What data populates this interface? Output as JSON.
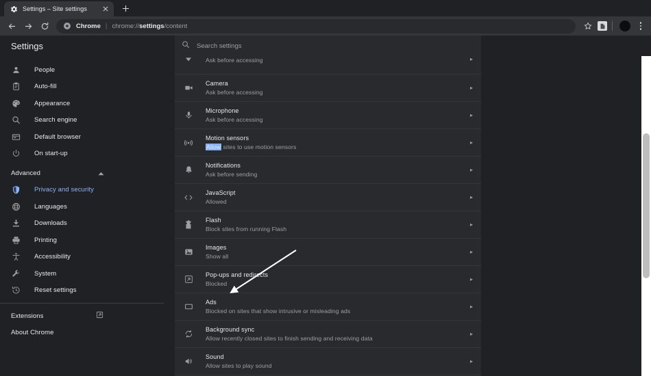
{
  "browser": {
    "tab": {
      "title": "Settings – Site settings",
      "favicon_icon": "gear-icon",
      "close_icon": "close-icon"
    },
    "newtab_label": "+",
    "toolbar": {
      "back_icon": "arrow-left-icon",
      "forward_icon": "arrow-right-icon",
      "reload_icon": "reload-icon",
      "security_icon": "chrome-globe-icon",
      "chip_label": "Chrome",
      "separator": "|",
      "url_prefix": "chrome://",
      "url_bold": "settings",
      "url_suffix": "/content",
      "bookmark_icon": "star-icon",
      "extension_icon": "extension-icon",
      "avatar_icon": "avatar",
      "menu_icon": "kebab-menu-icon"
    }
  },
  "settings": {
    "header_title": "Settings",
    "search": {
      "placeholder": "Search settings",
      "icon": "search-icon"
    }
  },
  "sidebar": {
    "items": [
      {
        "label": "People",
        "icon": "person-icon",
        "active": false
      },
      {
        "label": "Auto-fill",
        "icon": "clipboard-icon",
        "active": false
      },
      {
        "label": "Appearance",
        "icon": "palette-icon",
        "active": false
      },
      {
        "label": "Search engine",
        "icon": "search-icon",
        "active": false
      },
      {
        "label": "Default browser",
        "icon": "browser-window-icon",
        "active": false
      },
      {
        "label": "On start-up",
        "icon": "power-icon",
        "active": false
      }
    ],
    "advanced": {
      "label": "Advanced",
      "chevron_icon": "chevron-up-icon"
    },
    "advanced_items": [
      {
        "label": "Privacy and security",
        "icon": "shield-icon",
        "active": true
      },
      {
        "label": "Languages",
        "icon": "globe-icon",
        "active": false
      },
      {
        "label": "Downloads",
        "icon": "download-icon",
        "active": false
      },
      {
        "label": "Printing",
        "icon": "printer-icon",
        "active": false
      },
      {
        "label": "Accessibility",
        "icon": "accessibility-icon",
        "active": false
      },
      {
        "label": "System",
        "icon": "wrench-icon",
        "active": false
      },
      {
        "label": "Reset settings",
        "icon": "history-restore-icon",
        "active": false
      }
    ],
    "footer_items": [
      {
        "label": "Extensions",
        "external_icon": "external-link-icon"
      },
      {
        "label": "About Chrome",
        "external_icon": null
      }
    ]
  },
  "content_settings": {
    "rows": [
      {
        "title": "",
        "subtitle": "Ask before accessing",
        "icon": "location-pin-icon",
        "partial": true,
        "highlight": null
      },
      {
        "title": "Camera",
        "subtitle": "Ask before accessing",
        "icon": "camera-icon",
        "partial": false,
        "highlight": null
      },
      {
        "title": "Microphone",
        "subtitle": "Ask before accessing",
        "icon": "microphone-icon",
        "partial": false,
        "highlight": null
      },
      {
        "title": "Motion sensors",
        "subtitle": " sites to use motion sensors",
        "icon": "motion-sensor-icon",
        "partial": false,
        "highlight": "Allow"
      },
      {
        "title": "Notifications",
        "subtitle": "Ask before sending",
        "icon": "bell-icon",
        "partial": false,
        "highlight": null
      },
      {
        "title": "JavaScript",
        "subtitle": "Allowed",
        "icon": "code-brackets-icon",
        "partial": false,
        "highlight": null
      },
      {
        "title": "Flash",
        "subtitle": "Block sites from running Flash",
        "icon": "puzzle-piece-icon",
        "partial": false,
        "highlight": null
      },
      {
        "title": "Images",
        "subtitle": "Show all",
        "icon": "image-icon",
        "partial": false,
        "highlight": null
      },
      {
        "title": "Pop-ups and redirects",
        "subtitle": "Blocked",
        "icon": "popup-window-icon",
        "partial": false,
        "highlight": null
      },
      {
        "title": "Ads",
        "subtitle": "Blocked on sites that show intrusive or misleading ads",
        "icon": "rectangle-icon",
        "partial": false,
        "highlight": null
      },
      {
        "title": "Background sync",
        "subtitle": "Allow recently closed sites to finish sending and receiving data",
        "icon": "sync-icon",
        "partial": false,
        "highlight": null
      },
      {
        "title": "Sound",
        "subtitle": "Allow sites to play sound",
        "icon": "speaker-icon",
        "partial": false,
        "highlight": null
      }
    ],
    "row_arrow_icon": "chevron-right-icon"
  },
  "overlay": {
    "annotation_arrow_icon": "pointer-arrow-icon",
    "arrow_color": "#ffffff"
  },
  "scrollbar": {
    "track_color": "#ffffff",
    "thumb_color": "#bdbdbd"
  },
  "colors": {
    "accent": "#8ab4f8",
    "chrome_bg": "#202124",
    "panel_bg": "#292a2d",
    "tab_bg": "#35363a"
  }
}
